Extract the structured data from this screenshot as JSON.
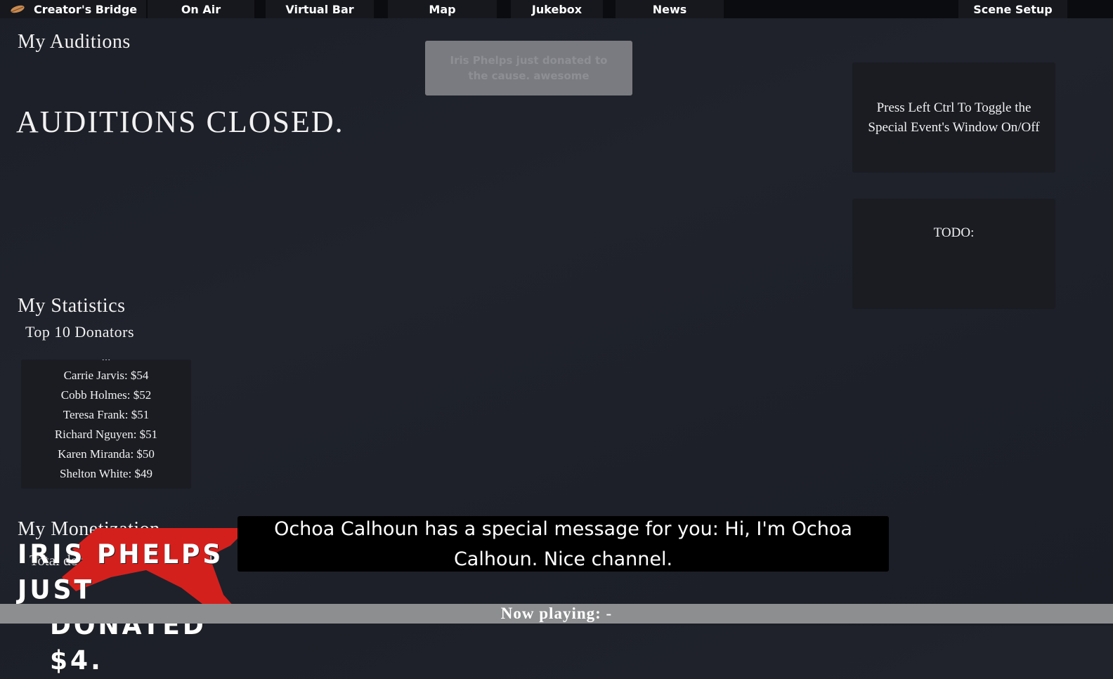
{
  "nav": {
    "brand": "Creator's Bridge",
    "items": [
      "On Air",
      "Virtual Bar",
      "Map",
      "Jukebox",
      "News"
    ],
    "scene_setup": "Scene Setup"
  },
  "auditions": {
    "heading": "My Auditions",
    "status": "AUDITIONS CLOSED."
  },
  "toast": {
    "text": "Iris Phelps just donated to the cause. awesome"
  },
  "help_panel": {
    "text": "Press Left Ctrl To Toggle the Special Event's Window On/Off"
  },
  "todo_panel": {
    "text": "TODO:"
  },
  "statistics": {
    "heading": "My Statistics",
    "subheading": "Top 10 Donators",
    "partial_entry": "...",
    "donators": [
      "Carrie Jarvis: $54",
      "Cobb Holmes: $52",
      "Teresa Frank: $51",
      "Richard Nguyen: $51",
      "Karen Miranda: $50",
      "Shelton White: $49"
    ]
  },
  "monetization": {
    "heading": "My Monetization",
    "label": "Total donation money received"
  },
  "donation_alert": {
    "line1": "Iris Phelps just",
    "line2": "donated $4."
  },
  "subtitle": {
    "text": "Ochoa Calhoun has a special message for you: Hi, I'm Ochoa Calhoun. Nice channel."
  },
  "now_playing": {
    "text": "Now playing: -"
  },
  "colors": {
    "accent_red": "#d4201c",
    "toast_bg": "#7a7b80",
    "panel_bg": "#1a1c22"
  }
}
